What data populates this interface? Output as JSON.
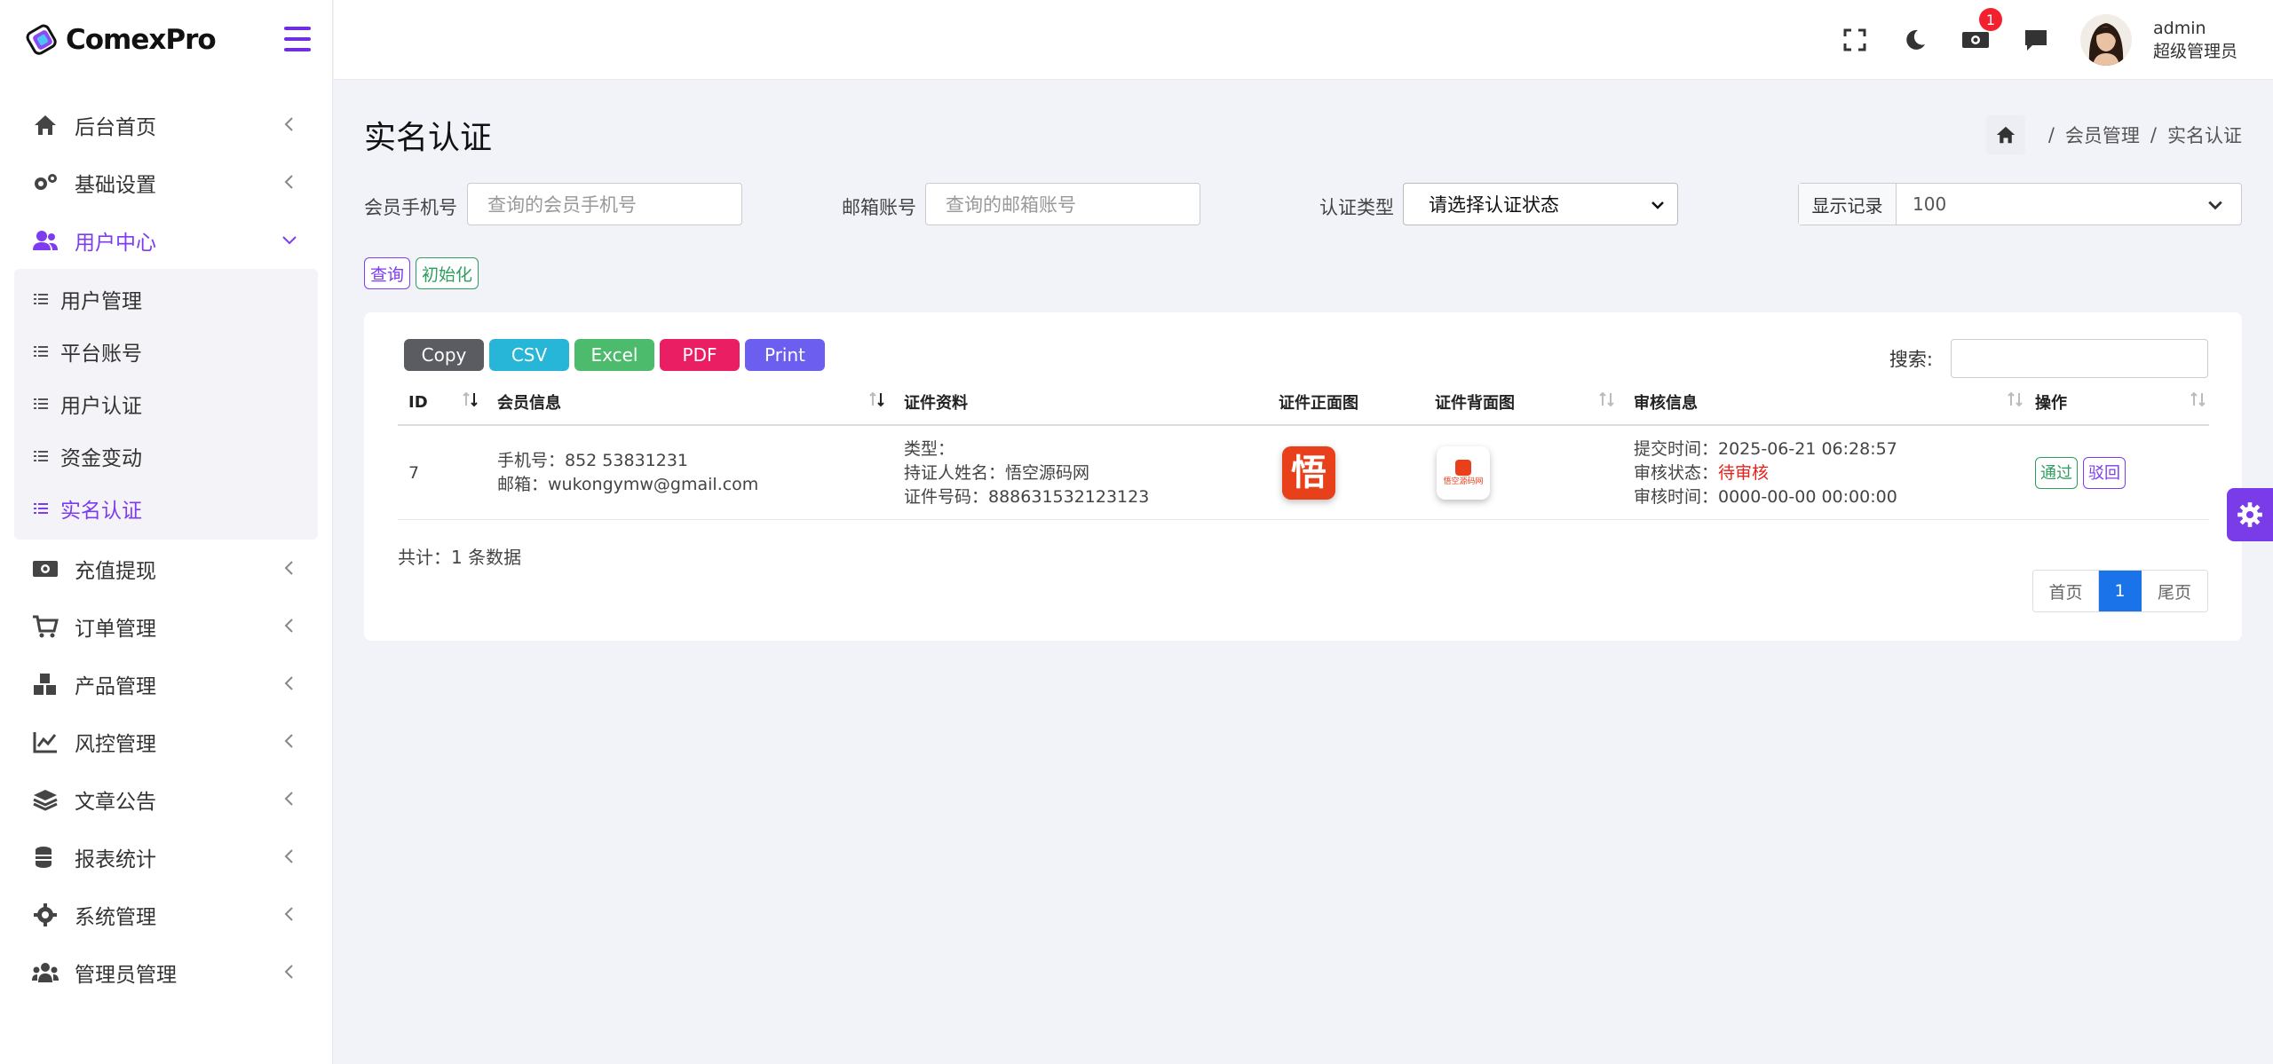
{
  "brand": {
    "name": "ComexPro"
  },
  "sidebar": {
    "items": [
      {
        "label": "后台首页"
      },
      {
        "label": "基础设置"
      },
      {
        "label": "用户中心"
      },
      {
        "label": "充值提现"
      },
      {
        "label": "订单管理"
      },
      {
        "label": "产品管理"
      },
      {
        "label": "风控管理"
      },
      {
        "label": "文章公告"
      },
      {
        "label": "报表统计"
      },
      {
        "label": "系统管理"
      },
      {
        "label": "管理员管理"
      }
    ],
    "submenu": [
      {
        "label": "用户管理"
      },
      {
        "label": "平台账号"
      },
      {
        "label": "用户认证"
      },
      {
        "label": "资金变动"
      },
      {
        "label": "实名认证"
      }
    ]
  },
  "header": {
    "notification_count": "1",
    "user_name": "admin",
    "user_role": "超级管理员"
  },
  "page": {
    "title": "实名认证",
    "breadcrumb": [
      "会员管理",
      "/",
      "实名认证",
      "/"
    ]
  },
  "filters": {
    "phone_label": "会员手机号",
    "phone_placeholder": "查询的会员手机号",
    "email_label": "邮箱账号",
    "email_placeholder": "查询的邮箱账号",
    "type_label": "认证类型",
    "type_value": "请选择认证状态",
    "records_label": "显示记录",
    "records_value": "100",
    "query_btn": "查询",
    "reset_btn": "初始化"
  },
  "exports": [
    "Copy",
    "CSV",
    "Excel",
    "PDF",
    "Print"
  ],
  "search_label": "搜索:",
  "table": {
    "headers": [
      "ID",
      "会员信息",
      "证件资料",
      "证件正面图",
      "证件背面图",
      "审核信息",
      "操作"
    ],
    "rows": [
      {
        "id": "7",
        "phone": "手机号：852 53831231",
        "email": "邮箱：wukongymw@gmail.com",
        "doc_type": "类型：",
        "doc_name": "持证人姓名：悟空源码网",
        "doc_no": "证件号码：888631532123123",
        "front_char": "悟",
        "back_text": "悟空源码网",
        "submit_time": "提交时间：2025-06-21 06:28:57",
        "status_label": "审核状态：",
        "status_value": "待审核",
        "review_time": "审核时间：0000-00-00 00:00:00",
        "approve": "通过",
        "reject": "驳回"
      }
    ]
  },
  "footer": {
    "total": "共计：1 条数据",
    "first": "首页",
    "current": "1",
    "last": "尾页"
  },
  "colors": {
    "accent": "#7d3cf0",
    "pending": "#e8201b",
    "pager_active": "#1a73e8"
  }
}
